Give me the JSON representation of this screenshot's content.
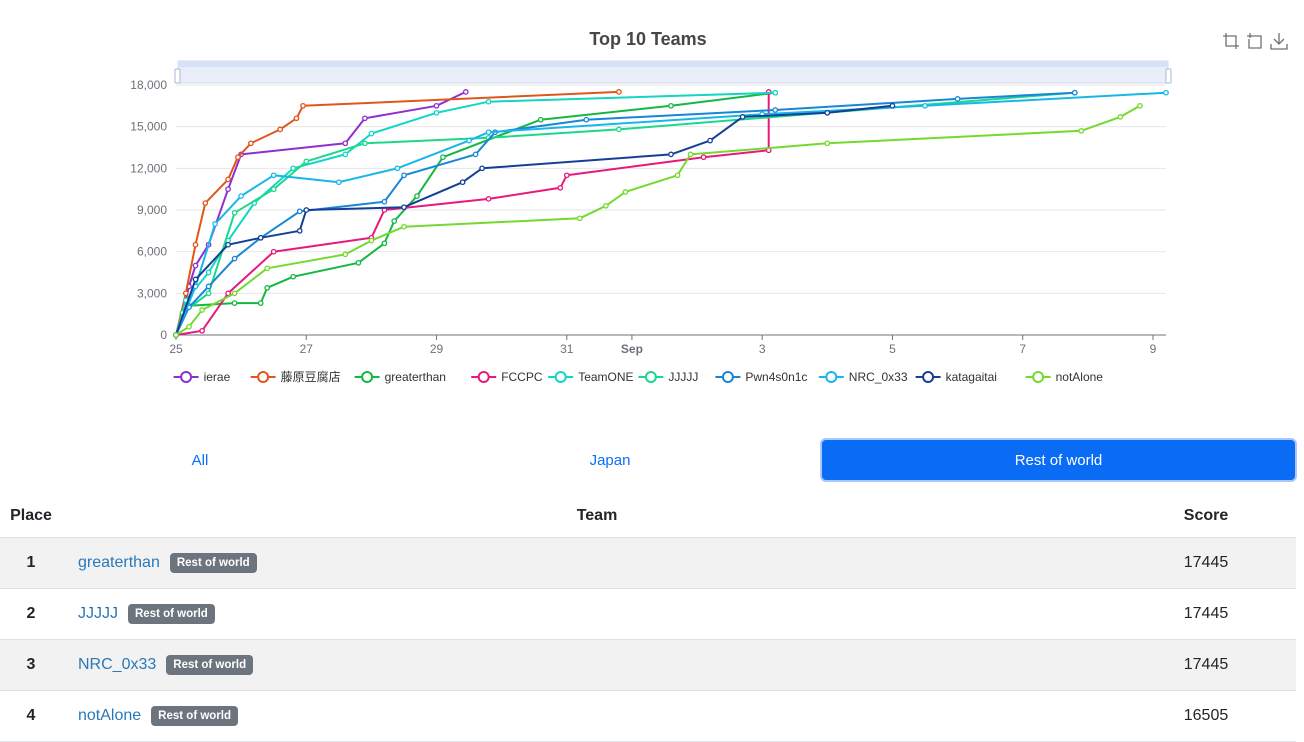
{
  "tabs": [
    {
      "label": "All",
      "active": false
    },
    {
      "label": "Japan",
      "active": false
    },
    {
      "label": "Rest of world",
      "active": true
    }
  ],
  "table": {
    "headers": {
      "place": "Place",
      "team": "Team",
      "score": "Score"
    },
    "rows": [
      {
        "place": "1",
        "team": "greaterthan",
        "badge": "Rest of world",
        "score": "17445"
      },
      {
        "place": "2",
        "team": "JJJJJ",
        "badge": "Rest of world",
        "score": "17445"
      },
      {
        "place": "3",
        "team": "NRC_0x33",
        "badge": "Rest of world",
        "score": "17445"
      },
      {
        "place": "4",
        "team": "notAlone",
        "badge": "Rest of world",
        "score": "16505"
      }
    ]
  },
  "toolbox": [
    "zoom-icon",
    "restore-icon",
    "download-icon"
  ],
  "chart_data": {
    "type": "line",
    "title": "Top 10 Teams",
    "xlabel": "",
    "ylabel": "",
    "xlim": [
      25,
      40.2
    ],
    "ylim": [
      0,
      18000
    ],
    "yticks": [
      0,
      3000,
      6000,
      9000,
      12000,
      15000,
      18000
    ],
    "ytick_labels": [
      "0",
      "3,000",
      "6,000",
      "9,000",
      "12,000",
      "15,000",
      "18,000"
    ],
    "xticks": [
      25,
      27,
      29,
      31,
      32,
      34,
      36,
      38,
      40
    ],
    "xtick_labels": [
      "25",
      "27",
      "29",
      "31",
      "Sep",
      "3",
      "5",
      "7",
      "9"
    ],
    "grid": true,
    "legend_position": "bottom",
    "series": [
      {
        "name": "ierae",
        "color": "#8e2fd1",
        "points": [
          [
            25.0,
            0
          ],
          [
            25.1,
            1500
          ],
          [
            25.2,
            3500
          ],
          [
            25.3,
            5000
          ],
          [
            25.5,
            6500
          ],
          [
            25.8,
            10500
          ],
          [
            26.0,
            13000
          ],
          [
            27.6,
            13800
          ],
          [
            27.9,
            15600
          ],
          [
            29.0,
            16500
          ],
          [
            29.45,
            17500
          ]
        ]
      },
      {
        "name": "藤原豆腐店",
        "color": "#e0561a",
        "points": [
          [
            25.0,
            0
          ],
          [
            25.15,
            3000
          ],
          [
            25.3,
            6500
          ],
          [
            25.45,
            9500
          ],
          [
            25.8,
            11200
          ],
          [
            25.95,
            12800
          ],
          [
            26.15,
            13800
          ],
          [
            26.6,
            14800
          ],
          [
            26.85,
            15600
          ],
          [
            26.95,
            16500
          ],
          [
            31.8,
            17500
          ]
        ]
      },
      {
        "name": "greaterthan",
        "color": "#13b843",
        "points": [
          [
            25.0,
            0
          ],
          [
            25.2,
            2100
          ],
          [
            25.9,
            2300
          ],
          [
            26.3,
            2300
          ],
          [
            26.4,
            3400
          ],
          [
            26.8,
            4200
          ],
          [
            27.8,
            5200
          ],
          [
            28.2,
            6600
          ],
          [
            28.35,
            8200
          ],
          [
            28.7,
            10000
          ],
          [
            29.1,
            12800
          ],
          [
            30.6,
            15500
          ],
          [
            32.6,
            16500
          ],
          [
            34.2,
            17445
          ]
        ]
      },
      {
        "name": "FCCPC",
        "color": "#e8197d",
        "points": [
          [
            25.0,
            0
          ],
          [
            25.4,
            300
          ],
          [
            25.8,
            3000
          ],
          [
            26.5,
            6000
          ],
          [
            28.0,
            7000
          ],
          [
            28.2,
            9000
          ],
          [
            29.8,
            9800
          ],
          [
            30.9,
            10600
          ],
          [
            31.0,
            11500
          ],
          [
            33.1,
            12800
          ],
          [
            34.1,
            13300
          ],
          [
            34.1,
            17500
          ]
        ]
      },
      {
        "name": "TeamONE",
        "color": "#11d6c5",
        "points": [
          [
            25.0,
            0
          ],
          [
            25.15,
            2500
          ],
          [
            25.5,
            4500
          ],
          [
            25.8,
            6800
          ],
          [
            26.2,
            9500
          ],
          [
            26.8,
            12000
          ],
          [
            27.6,
            13000
          ],
          [
            28.0,
            14500
          ],
          [
            29.0,
            16000
          ],
          [
            29.8,
            16800
          ],
          [
            34.2,
            17445
          ]
        ]
      },
      {
        "name": "JJJJJ",
        "color": "#1bd88a",
        "points": [
          [
            25.0,
            0
          ],
          [
            25.1,
            1600
          ],
          [
            25.5,
            3000
          ],
          [
            25.9,
            8800
          ],
          [
            26.5,
            10500
          ],
          [
            27.0,
            12500
          ],
          [
            27.9,
            13800
          ],
          [
            29.8,
            14200
          ],
          [
            31.8,
            14800
          ],
          [
            38.8,
            17445
          ]
        ]
      },
      {
        "name": "Pwn4s0n1c",
        "color": "#1886d6",
        "points": [
          [
            25.0,
            0
          ],
          [
            25.2,
            2000
          ],
          [
            25.5,
            3500
          ],
          [
            25.9,
            5500
          ],
          [
            26.3,
            7000
          ],
          [
            26.9,
            8900
          ],
          [
            28.2,
            9600
          ],
          [
            28.5,
            11500
          ],
          [
            29.6,
            13000
          ],
          [
            29.9,
            14600
          ],
          [
            31.3,
            15500
          ],
          [
            34.2,
            16200
          ],
          [
            37.0,
            17000
          ],
          [
            38.8,
            17445
          ]
        ]
      },
      {
        "name": "NRC_0x33",
        "color": "#17b7ea",
        "points": [
          [
            25.0,
            0
          ],
          [
            25.3,
            3500
          ],
          [
            25.6,
            8000
          ],
          [
            26.0,
            10000
          ],
          [
            26.5,
            11500
          ],
          [
            27.5,
            11000
          ],
          [
            28.4,
            12000
          ],
          [
            29.5,
            14000
          ],
          [
            29.8,
            14600
          ],
          [
            34.0,
            15900
          ],
          [
            36.5,
            16500
          ],
          [
            40.2,
            17445
          ]
        ]
      },
      {
        "name": "katagaitai",
        "color": "#153e96",
        "points": [
          [
            25.0,
            0
          ],
          [
            25.3,
            4000
          ],
          [
            25.8,
            6500
          ],
          [
            26.3,
            7000
          ],
          [
            26.9,
            7500
          ],
          [
            27.0,
            9000
          ],
          [
            28.5,
            9200
          ],
          [
            29.4,
            11000
          ],
          [
            29.7,
            12000
          ],
          [
            32.6,
            13000
          ],
          [
            33.2,
            14000
          ],
          [
            33.7,
            15700
          ],
          [
            35.0,
            16000
          ],
          [
            36.0,
            16500
          ]
        ]
      },
      {
        "name": "notAlone",
        "color": "#74da2f",
        "points": [
          [
            25.0,
            0
          ],
          [
            25.2,
            600
          ],
          [
            25.4,
            1800
          ],
          [
            25.9,
            3000
          ],
          [
            26.4,
            4800
          ],
          [
            27.6,
            5800
          ],
          [
            28.0,
            6800
          ],
          [
            28.5,
            7800
          ],
          [
            31.2,
            8400
          ],
          [
            31.6,
            9300
          ],
          [
            31.9,
            10300
          ],
          [
            32.7,
            11500
          ],
          [
            32.9,
            13000
          ],
          [
            35.0,
            13800
          ],
          [
            38.9,
            14700
          ],
          [
            39.5,
            15700
          ],
          [
            39.8,
            16505
          ]
        ]
      }
    ]
  }
}
